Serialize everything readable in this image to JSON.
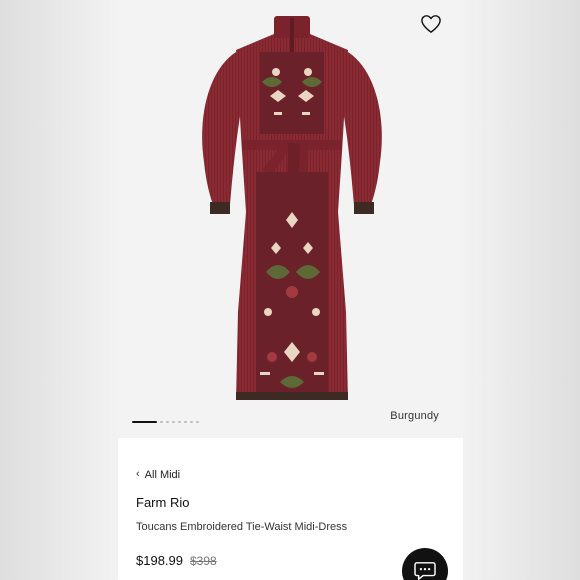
{
  "product": {
    "color_label": "Burgundy",
    "breadcrumb_label": "All Midi",
    "brand": "Farm Rio",
    "name": "Toucans Embroidered Tie-Waist Midi-Dress",
    "price": "$198.99",
    "original_price": "$398",
    "image_count": 8,
    "active_image_index": 1
  },
  "colors": {
    "dress": "#8a2a33",
    "accent": "#111111"
  },
  "icons": {
    "favorite": "heart-outline-icon",
    "back": "chevron-left-icon",
    "chat": "chat-bubble-icon"
  }
}
